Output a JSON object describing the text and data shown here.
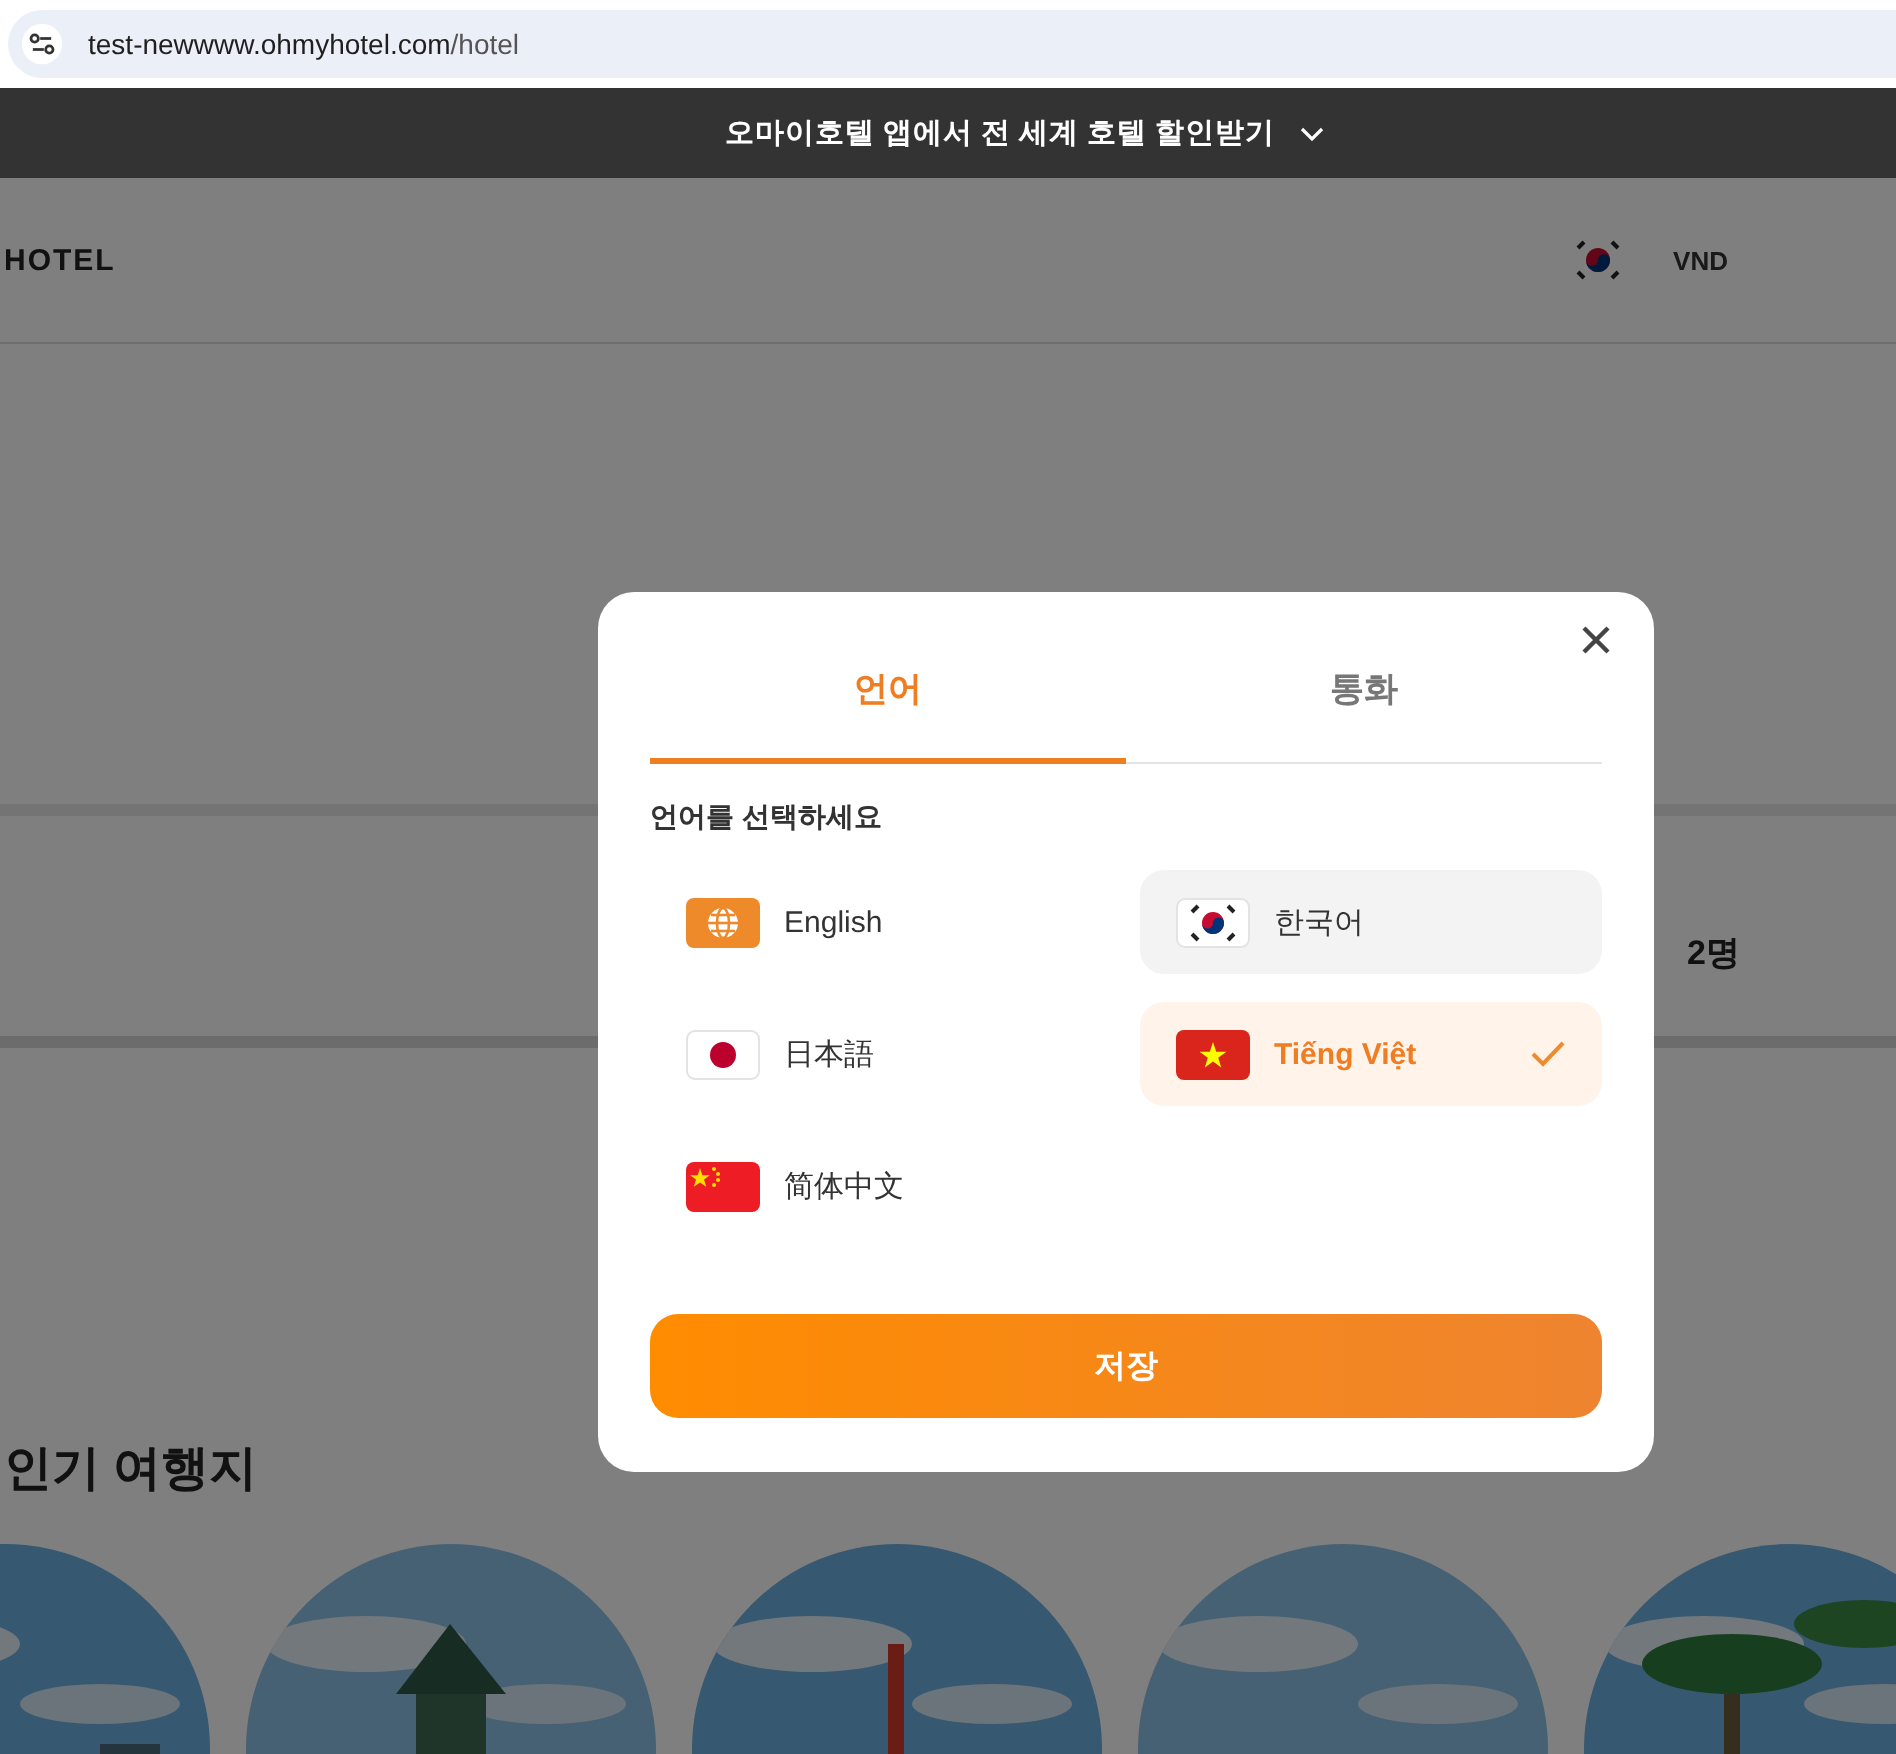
{
  "browser": {
    "url_host": "test-newwww.ohmyhotel.com",
    "url_path": "/hotel"
  },
  "banner": {
    "text": "오마이호텔 앱에서 전 세계 호텔 할인받기"
  },
  "page": {
    "logo": "HOTEL",
    "currency": "VND",
    "guests": "2명",
    "section_title": "인기 여행지"
  },
  "modal": {
    "tabs": [
      {
        "label": "언어",
        "selected": true
      },
      {
        "label": "통화",
        "selected": false
      }
    ],
    "prompt": "언어를 선택하세요",
    "languages": [
      {
        "label": "English",
        "kind": "globe",
        "selected": false,
        "highlighted": false
      },
      {
        "label": "한국어",
        "kind": "kr",
        "selected": false,
        "highlighted": true
      },
      {
        "label": "日本語",
        "kind": "jp",
        "selected": false,
        "highlighted": false
      },
      {
        "label": "Tiếng Việt",
        "kind": "vn",
        "selected": true,
        "highlighted": false
      },
      {
        "label": "简体中文",
        "kind": "cn",
        "selected": false,
        "highlighted": false
      }
    ],
    "save": "저장"
  }
}
